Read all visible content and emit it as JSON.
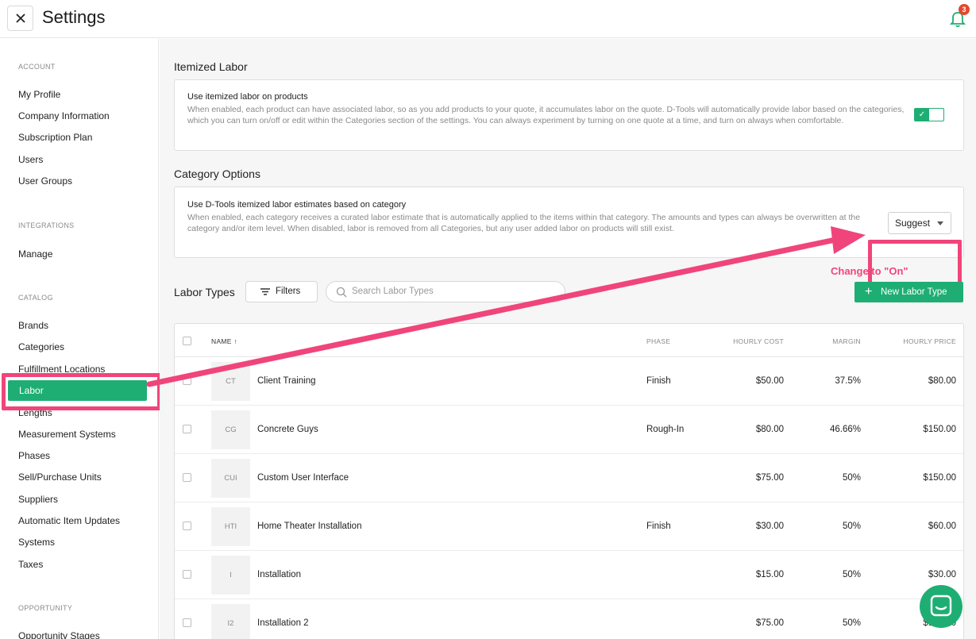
{
  "header": {
    "title": "Settings",
    "notification_count": "3"
  },
  "sidebar": {
    "sections": [
      {
        "label": "ACCOUNT",
        "items": [
          "My Profile",
          "Company Information",
          "Subscription Plan",
          "Users",
          "User Groups"
        ]
      },
      {
        "label": "INTEGRATIONS",
        "items": [
          "Manage"
        ]
      },
      {
        "label": "CATALOG",
        "items": [
          "Brands",
          "Categories",
          "Fulfillment Locations",
          "Labor",
          "Lengths",
          "Measurement Systems",
          "Phases",
          "Sell/Purchase Units",
          "Suppliers",
          "Automatic Item Updates",
          "Systems",
          "Taxes"
        ]
      },
      {
        "label": "OPPORTUNITY",
        "items": [
          "Opportunity Stages"
        ]
      }
    ],
    "active_item": "Labor"
  },
  "itemized": {
    "heading": "Itemized Labor",
    "title": "Use itemized labor on products",
    "desc": "When enabled, each product can have associated labor, so as you add products to your quote, it accumulates labor on the quote. D-Tools will automatically provide labor based on the categories, which you can turn on/off or edit within the Categories section of the settings. You can always experiment by turning on one quote at a time, and turn on always when comfortable.",
    "toggle_state": "on"
  },
  "category": {
    "heading": "Category Options",
    "title": "Use D-Tools itemized labor estimates based on category",
    "desc": "When enabled, each category receives a curated labor estimate that is automatically applied to the items within that category. The amounts and types can always be overwritten at the category and/or item level. When disabled, labor is removed from all Categories, but any user added labor on products will still exist.",
    "select_value": "Suggest",
    "callout": "Change to \"On\""
  },
  "labor_types": {
    "heading": "Labor Types",
    "filters_label": "Filters",
    "search_placeholder": "Search Labor Types",
    "new_button": "New Labor Type",
    "columns": [
      "NAME",
      "PHASE",
      "HOURLY COST",
      "MARGIN",
      "HOURLY PRICE"
    ],
    "rows": [
      {
        "abbr": "CT",
        "name": "Client Training",
        "phase": "Finish",
        "cost": "$50.00",
        "margin": "37.5%",
        "price": "$80.00"
      },
      {
        "abbr": "CG",
        "name": "Concrete Guys",
        "phase": "Rough-In",
        "cost": "$80.00",
        "margin": "46.66%",
        "price": "$150.00"
      },
      {
        "abbr": "CUI",
        "name": "Custom User Interface",
        "phase": "",
        "cost": "$75.00",
        "margin": "50%",
        "price": "$150.00"
      },
      {
        "abbr": "HTI",
        "name": "Home Theater Installation",
        "phase": "Finish",
        "cost": "$30.00",
        "margin": "50%",
        "price": "$60.00"
      },
      {
        "abbr": "I",
        "name": "Installation",
        "phase": "",
        "cost": "$15.00",
        "margin": "50%",
        "price": "$30.00"
      },
      {
        "abbr": "I2",
        "name": "Installation 2",
        "phase": "",
        "cost": "$75.00",
        "margin": "50%",
        "price": "$150.00"
      }
    ]
  },
  "colors": {
    "accent": "#1eae73",
    "annotation": "#f0457a",
    "badge": "#e0492f"
  }
}
